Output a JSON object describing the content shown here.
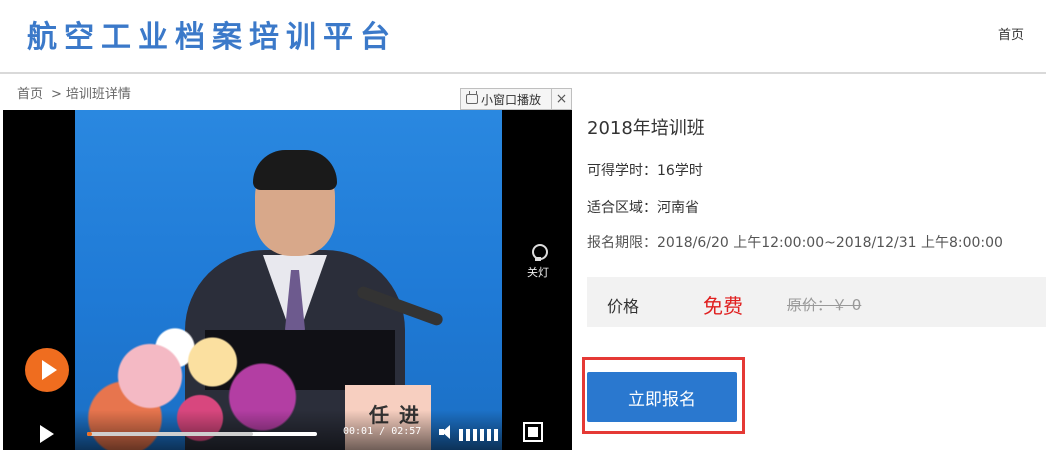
{
  "header": {
    "site_title": "航空工业档案培训平台",
    "nav_home": "首页"
  },
  "breadcrumb": {
    "home": "首页",
    "separator": ">",
    "current": "培训班详情"
  },
  "player": {
    "mini_window_label": "小窗口播放",
    "mini_window_close": "×",
    "light_toggle_label": "关灯",
    "current_time": "00:01",
    "duration": "02:57",
    "time_separator": "/",
    "progress_fraction": 0.006,
    "buffer_fraction": 0.72,
    "accent_color": "#ef6d1f",
    "nameplate_text": "任进"
  },
  "course": {
    "title": "2018年培训班",
    "credit_hours_label": "可得学时：",
    "credit_hours_value": "16学时",
    "region_label": "适合区域：",
    "region_value": "河南省",
    "period_label": "报名期限：",
    "period_value": "2018/6/20 上午12:00:00~2018/12/31 上午8:00:00"
  },
  "price": {
    "label": "价格",
    "free_text": "免费",
    "original_text": "原价：￥ 0",
    "free_color": "#e02020"
  },
  "actions": {
    "signup_label": "立即报名",
    "signup_color": "#2a78cf",
    "highlight_color": "#e53935"
  }
}
